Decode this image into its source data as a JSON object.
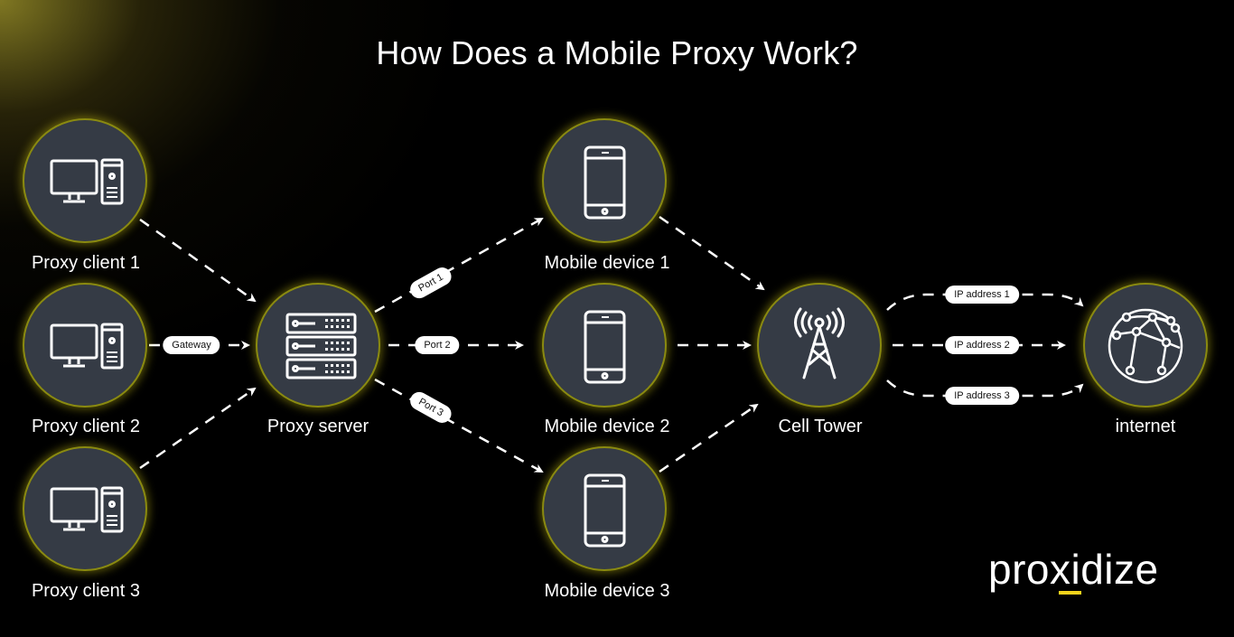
{
  "title": "How Does a Mobile Proxy Work?",
  "nodes": {
    "client1": {
      "label": "Proxy  client 1",
      "icon": "desktop-computer-icon"
    },
    "client2": {
      "label": "Proxy  client 2",
      "icon": "desktop-computer-icon"
    },
    "client3": {
      "label": "Proxy  client 3",
      "icon": "desktop-computer-icon"
    },
    "server": {
      "label": "Proxy  server",
      "icon": "server-rack-icon"
    },
    "mobile1": {
      "label": "Mobile device 1",
      "icon": "smartphone-icon"
    },
    "mobile2": {
      "label": "Mobile device 2",
      "icon": "smartphone-icon"
    },
    "mobile3": {
      "label": "Mobile device 3",
      "icon": "smartphone-icon"
    },
    "tower": {
      "label": "Cell Tower",
      "icon": "cell-tower-icon"
    },
    "internet": {
      "label": "internet",
      "icon": "globe-network-icon"
    }
  },
  "edge_labels": {
    "gateway": "Gateway",
    "port1": "Port 1",
    "port2": "Port 2",
    "port3": "Port 3",
    "ip1": "IP address 1",
    "ip2": "IP address 2",
    "ip3": "IP address 3"
  },
  "logo": {
    "text": "proxidize"
  },
  "colors": {
    "background": "#000000",
    "node_fill": "#353b45",
    "node_glow": "#c8be14",
    "accent": "#f2d21b",
    "text": "#ffffff"
  }
}
